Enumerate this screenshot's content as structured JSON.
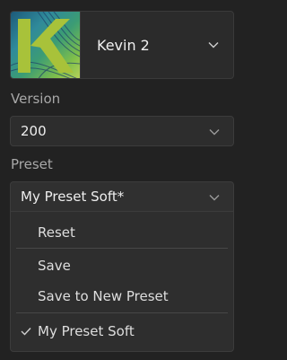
{
  "instrument": {
    "name": "Kevin 2",
    "logo_letter": "K",
    "chevron_icon": "chevron-down-icon"
  },
  "version": {
    "label": "Version",
    "selected": "200"
  },
  "preset": {
    "label": "Preset",
    "selected": "My Preset Soft*",
    "menu": {
      "reset": "Reset",
      "save": "Save",
      "save_new": "Save to New Preset",
      "current": "My Preset Soft",
      "current_checked": true
    }
  },
  "colors": {
    "background": "#222222",
    "text": "#dcdcdc",
    "label": "#a8a8a8",
    "logo_green": "#a8c23a"
  }
}
